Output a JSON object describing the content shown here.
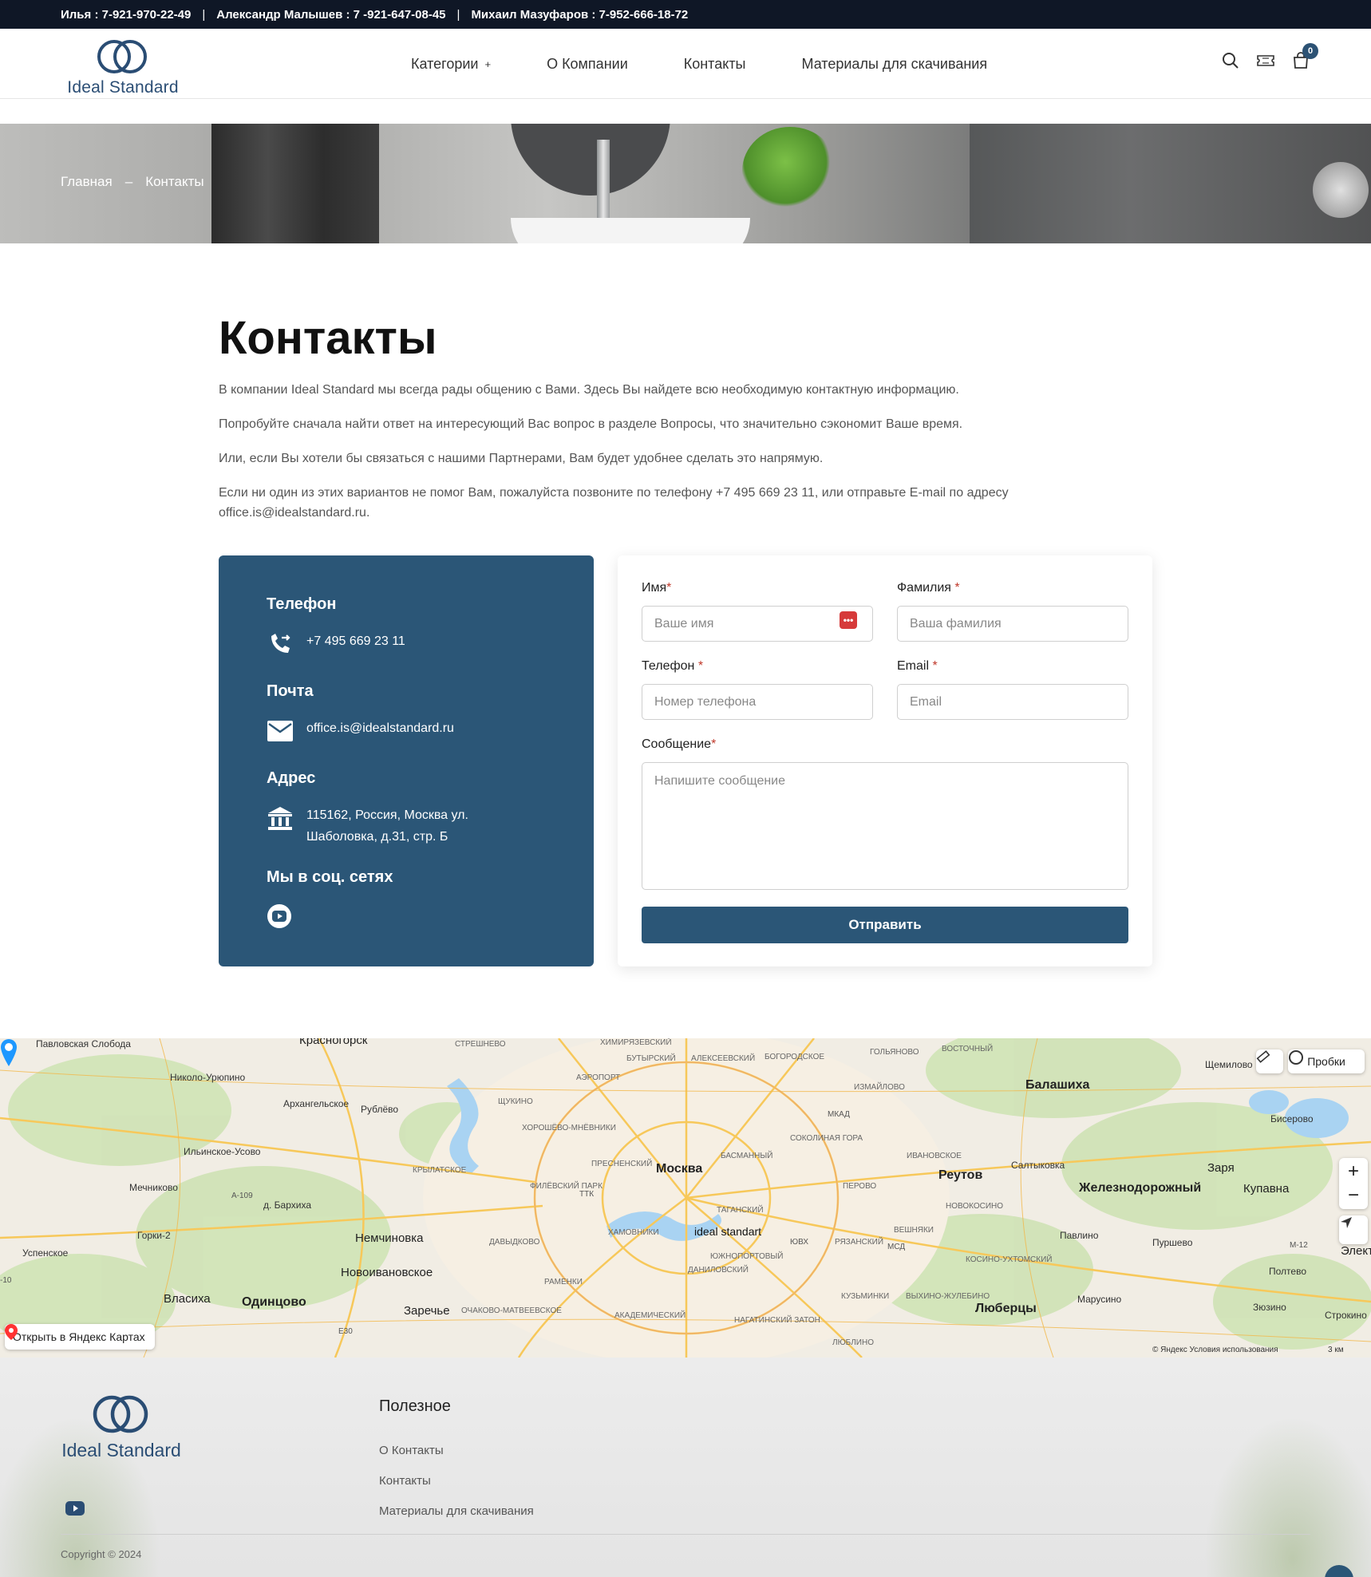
{
  "topbar": {
    "contacts": [
      "Илья : 7-921-970-22-49",
      "Александр Малышев : 7 -921-647-08-45",
      "Михаил Мазуфаров : 7-952-666-18-72"
    ],
    "separator": "|"
  },
  "header": {
    "brand": "Ideal Standard",
    "nav": [
      {
        "label": "Категории",
        "has_submenu": true,
        "submenu_icon": "+"
      },
      {
        "label": "О Компании"
      },
      {
        "label": "Контакты"
      },
      {
        "label": "Материалы для скачивания"
      }
    ],
    "icons": [
      "search-icon",
      "ticket-icon",
      "cart-icon"
    ],
    "cart_count": "0"
  },
  "banner": {
    "breadcrumb": {
      "home": "Главная",
      "separator": "–",
      "current": "Контакты"
    }
  },
  "main": {
    "title": "Контакты",
    "intro": [
      "В компании Ideal Standard мы всегда рады общению с Вами. Здесь Вы найдете всю необходимую контактную информацию.",
      "Попробуйте сначала найти ответ на интересующий Вас вопрос в разделе Вопросы, что значительно сэкономит Ваше время.",
      "Или, если Вы хотели бы связаться с нашими Партнерами, Вам будет удобнее сделать это напрямую.",
      "Если ни один из этих вариантов не помог Вам, пожалуйста позвоните по телефону +7 495 669 23 11, или отправьте E-mail по адресу office.is@idealstandard.ru."
    ]
  },
  "info_card": {
    "bg_color": "#2b5677",
    "phone": {
      "heading": "Телефон",
      "value": "+7 495 669 23 11",
      "icon": "phone-forward-icon"
    },
    "mail": {
      "heading": "Почта",
      "value": "office.is@idealstandard.ru",
      "icon": "envelope-icon"
    },
    "address": {
      "heading": "Адрес",
      "line1": "115162, Россия, Москва ул.",
      "line2": "Шаболовка, д.31, стр. Б",
      "icon": "bank-building-icon"
    },
    "social": {
      "heading": "Мы в соц. сетях",
      "icons": [
        "youtube-icon"
      ]
    }
  },
  "form": {
    "first_name": {
      "label": "Имя",
      "required_mark": "*",
      "placeholder": "Ваше имя",
      "value": ""
    },
    "last_name": {
      "label": "Фамилия",
      "required_mark": "*",
      "placeholder": "Ваша фамилия",
      "value": ""
    },
    "phone": {
      "label": "Телефон",
      "required_mark": "*",
      "placeholder": "Номер телефона",
      "value": ""
    },
    "email": {
      "label": "Email",
      "required_mark": "*",
      "placeholder": "Email",
      "value": ""
    },
    "message": {
      "label": "Сообщение",
      "required_mark": "*",
      "placeholder": "Напишите сообщение",
      "value": ""
    },
    "password_manager_icon": "•••",
    "submit_label": "Отправить",
    "submit_color": "#2b5677"
  },
  "map": {
    "marker_label": "ideal standart",
    "city": "Москва",
    "open_button": "Открыть в Яндекс Картах",
    "traffic_button": "Пробки",
    "zoom_in": "+",
    "zoom_out": "−",
    "copyright": "© Яндекс   Условия использования",
    "scale": "3 км",
    "places_big": [
      "Москва",
      "Балашиха",
      "Реутов",
      "Железнодорожный",
      "Люберцы",
      "Одинцово",
      "Немчиновка"
    ],
    "places": [
      "Павловская Слобода",
      "Николо-Урюпино",
      "Архангельское",
      "Рублёво",
      "Ильинское-Усово",
      "Мечниково",
      "д. Бархиха",
      "Горки-2",
      "Успенское",
      "Новоивановское",
      "Заречье",
      "Красногорск",
      "Щемилово",
      "Бисерово",
      "Заря",
      "Купавна",
      "Салтыковка",
      "Павлино",
      "Пуршево",
      "Полтево",
      "Марусино",
      "Зюзино",
      "Строкино",
      "Власиха",
      "Элект"
    ],
    "districts": [
      "ХИМИРЯЗЕВСКИЙ",
      "БУТЫРСКИЙ",
      "АЛЕКСЕЕВСКИЙ",
      "БОГОРОДСКОЕ",
      "ГОЛЬЯНОВО",
      "ВОСТОЧНЫЙ",
      "СТРЕШНЕВО",
      "АЭРОПОРТ",
      "ИЗМАЙЛОВО",
      "ЩУКИНО",
      "ХОРОШЁВО-МНЁВНИКИ",
      "СОКОЛИНАЯ ГОРА",
      "ИВАНОВСКОЕ",
      "БАСМАННЫЙ",
      "ПРЕСНЕНСКИЙ",
      "КРЫЛАТСКОЕ",
      "ФИЛЁВСКИЙ ПАРК",
      "ПЕРОВО",
      "НОВОКОСИНО",
      "ТАГАНСКИЙ",
      "ХАМОВНИКИ",
      "ВЕШНЯКИ",
      "РЯЗАНСКИЙ",
      "ДАВЫДКОВО",
      "ЮЖНОПОРТОВЫЙ",
      "ДАНИЛОВСКИЙ",
      "КОСИНО-УХТОМСКИЙ",
      "РАМЕНКИ",
      "КУЗЬМИНКИ",
      "ВЫХИНО-ЖУЛЕБИНО",
      "ОЧАКОВО-МАТВЕЕВСКОЕ",
      "АКАДЕМИЧЕСКИЙ",
      "НАГАТИНСКИЙ ЗАТОН",
      "ЛЮБЛИНО"
    ],
    "road_labels": [
      "МКАД",
      "ТТК",
      "МСД",
      "ЮВХ",
      "E30",
      "M-12",
      "A-109",
      "-10"
    ]
  },
  "footer": {
    "brand": "Ideal Standard",
    "social_icons": [
      "youtube-icon"
    ],
    "useful_heading": "Полезное",
    "links": [
      "О Контакты",
      "Контакты",
      "Материалы для скачивания"
    ],
    "copyright": "Copyright © 2024"
  }
}
